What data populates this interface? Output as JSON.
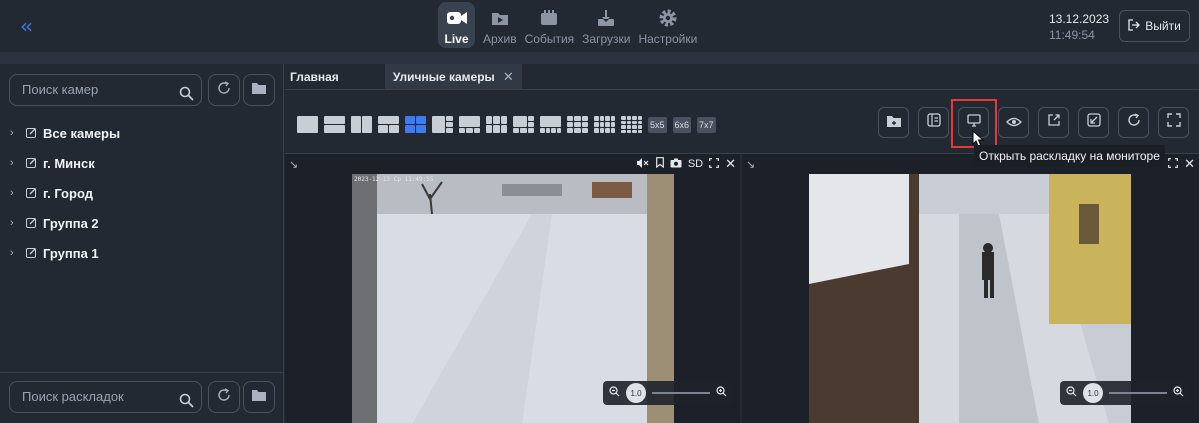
{
  "header": {
    "nav": [
      {
        "label": "Live",
        "icon": "video-camera-icon",
        "active": true
      },
      {
        "label": "Архив",
        "icon": "archive-play-icon",
        "active": false
      },
      {
        "label": "События",
        "icon": "events-icon",
        "active": false
      },
      {
        "label": "Загрузки",
        "icon": "download-icon",
        "active": false
      },
      {
        "label": "Настройки",
        "icon": "gear-icon",
        "active": false
      }
    ],
    "date": "13.12.2023",
    "time": "11:49:54",
    "exit_label": "Выйти"
  },
  "sidebar": {
    "camera_search_placeholder": "Поиск камер",
    "tree": [
      {
        "label": "Все камеры"
      },
      {
        "label": "г. Минск"
      },
      {
        "label": "г. Город"
      },
      {
        "label": "Группа 2"
      },
      {
        "label": "Группа 1"
      }
    ],
    "layout_search_placeholder": "Поиск раскладок"
  },
  "main": {
    "tabs": [
      {
        "label": "Главная",
        "active": false
      },
      {
        "label": "Уличные камеры",
        "active": true
      }
    ],
    "grid_text_options": [
      "5x5",
      "6x6",
      "7x7"
    ],
    "tooltip": "Открыть раскладку на мониторе",
    "tiles": [
      {
        "quality": "SD",
        "zoom": "1.0",
        "timestamp": "2023-12-13 Ср 11:49:55"
      },
      {
        "zoom": "1.0"
      }
    ]
  },
  "colors": {
    "accent": "#3d7bf0",
    "background": "#222933",
    "highlight": "#e53935"
  }
}
